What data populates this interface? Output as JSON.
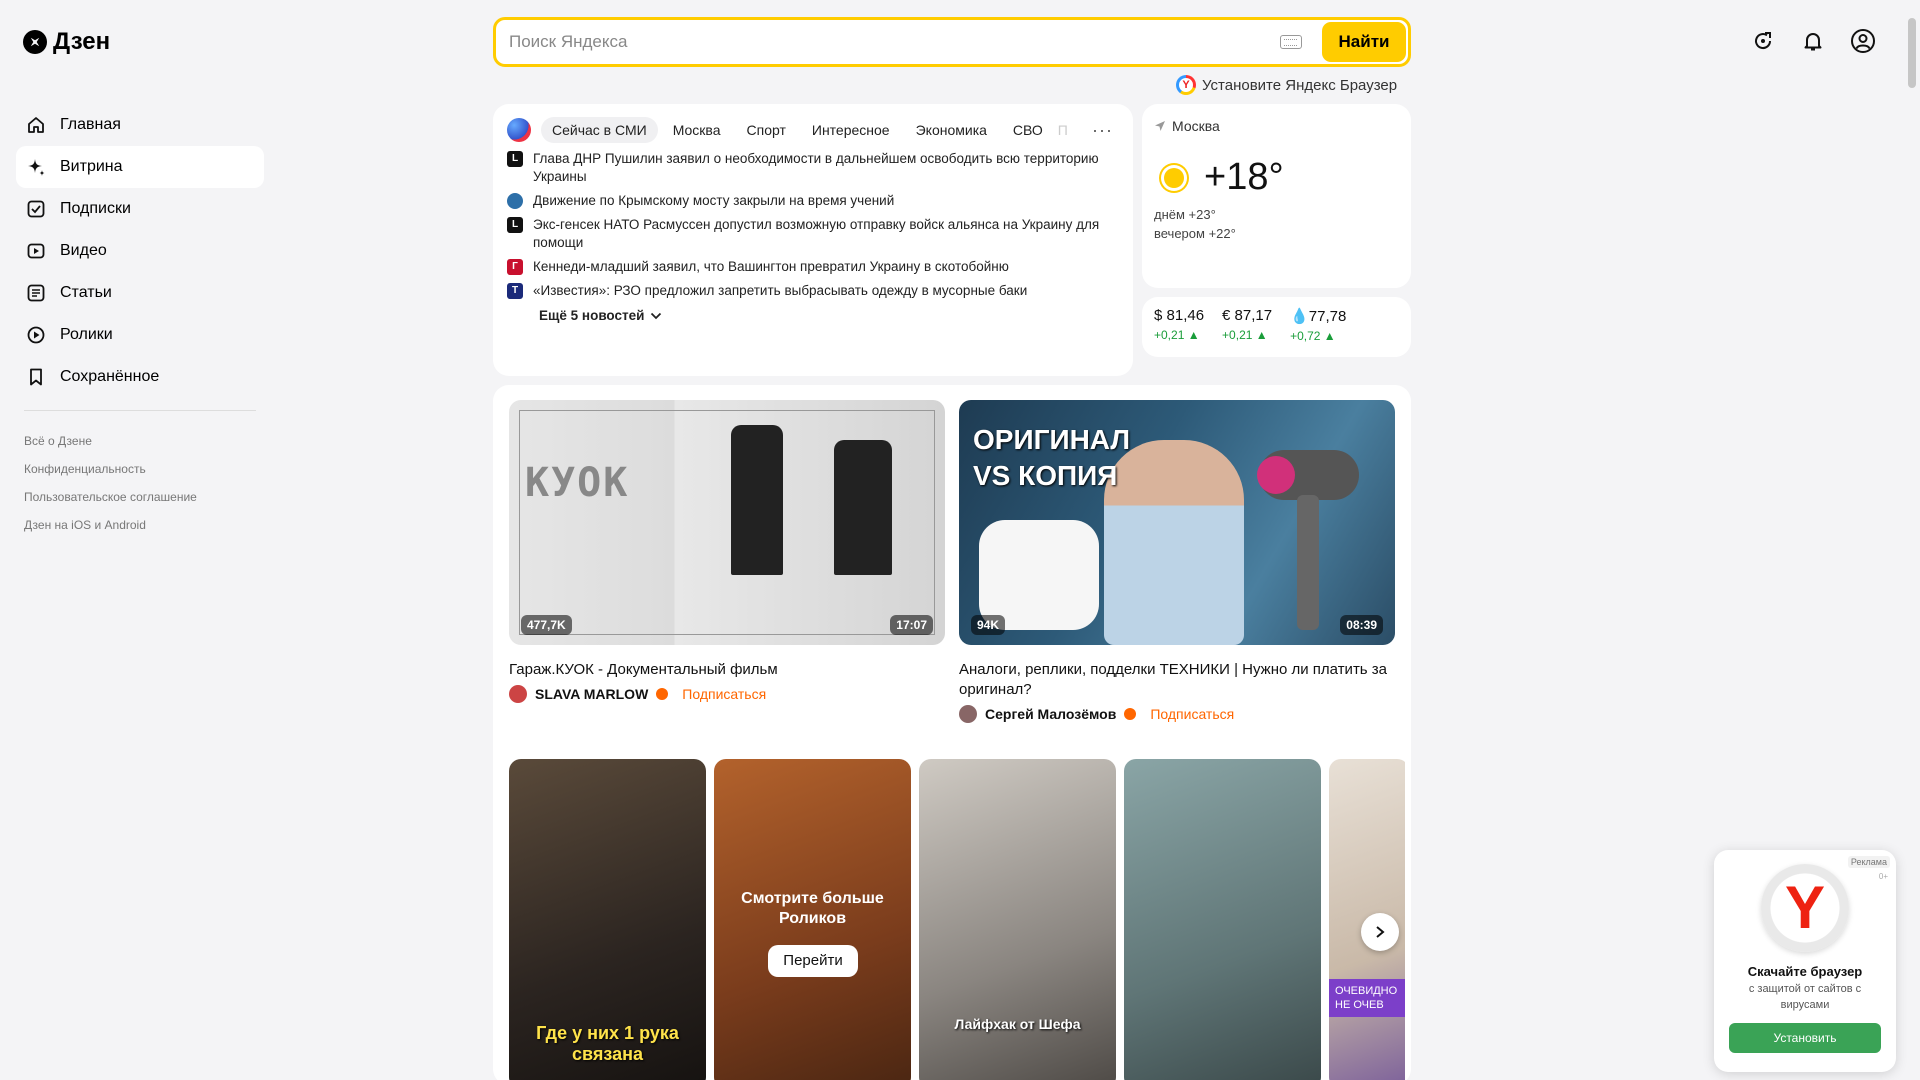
{
  "app": {
    "logo_text": "Дзен"
  },
  "colors": {
    "accent_yellow": "#ffcc00",
    "subscribe_orange": "#ff6600",
    "positive_green": "#1a9d3a",
    "ad_button_green": "#3aa356"
  },
  "sidebar": {
    "items": [
      {
        "label": "Главная",
        "icon": "home-icon"
      },
      {
        "label": "Витрина",
        "icon": "sparkle-icon"
      },
      {
        "label": "Подписки",
        "icon": "checkbox-icon"
      },
      {
        "label": "Видео",
        "icon": "video-icon"
      },
      {
        "label": "Статьи",
        "icon": "article-icon"
      },
      {
        "label": "Ролики",
        "icon": "shorts-icon"
      },
      {
        "label": "Сохранённое",
        "icon": "bookmark-icon"
      }
    ],
    "footer_links": [
      "Всё о Дзене",
      "Конфиденциальность",
      "Пользовательское соглашение",
      "Дзен на iOS и Android"
    ]
  },
  "search": {
    "placeholder": "Поиск Яндекса",
    "button": "Найти",
    "install_prompt": "Установите Яндекс Браузер"
  },
  "news": {
    "tabs": [
      "Сейчас в СМИ",
      "Москва",
      "Спорт",
      "Интересное",
      "Экономика",
      "СВО",
      "П"
    ],
    "more": "···",
    "items": [
      {
        "source_letter": "L",
        "source_color": "#111111",
        "text": "Глава ДНР Пушилин заявил о необходимости в дальнейшем освободить всю территорию Украины"
      },
      {
        "source_letter": "",
        "source_color": "#2d6fa8",
        "text": "Движение по Крымскому мосту закрыли на время учений"
      },
      {
        "source_letter": "L",
        "source_color": "#111111",
        "text": "Экс-генсек НАТО Расмуссен допустил возможную отправку войск альянса на Украину для помощи"
      },
      {
        "source_letter": "Г",
        "source_color": "#c8102e",
        "text": "Кеннеди-младший заявил, что Вашингтон превратил Украину в скотобойню"
      },
      {
        "source_letter": "T",
        "source_color": "#1b2a7a",
        "text": "«Известия»: РЗО предложил запретить выбрасывать одежду в мусорные баки"
      }
    ],
    "expand": "Ещё 5 новостей"
  },
  "weather": {
    "location": "Москва",
    "temp": "+18°",
    "day": "днём +23°",
    "evening": "вечером +22°"
  },
  "currency": [
    {
      "label": "$ 81,46",
      "change": "+0,21 ▲"
    },
    {
      "label": "€ 87,17",
      "change": "+0,21 ▲"
    },
    {
      "label": "💧77,78",
      "change": "+0,72 ▲"
    }
  ],
  "videos": [
    {
      "views": "477,7K",
      "duration": "17:07",
      "title": "Гараж.КУОК - Документальный фильм",
      "author": "SLAVA MARLOW",
      "subscribe": "Подписаться",
      "thumb_text": "КУОК"
    },
    {
      "views": "94K",
      "duration": "08:39",
      "title": "Аналоги, реплики, подделки ТЕХНИКИ | Нужно ли платить за оригинал?",
      "author": "Сергей Малозёмов",
      "subscribe": "Подписаться",
      "thumb_text": "ОРИГИНАЛ VS КОПИЯ"
    }
  ],
  "shorts": {
    "s1_caption": "Где у них 1 рука связана",
    "s2_more": "Смотрите больше Роликов",
    "s2_button": "Перейти",
    "s3_caption": "Лайфхак от Шефа",
    "s5_tag": "ОЧЕВИДНО НЕ ОЧЕВ"
  },
  "ad": {
    "label": "Реклама",
    "age": "0+",
    "title": "Скачайте браузер",
    "desc": "с защитой от сайтов с вирусами",
    "button": "Установить"
  }
}
